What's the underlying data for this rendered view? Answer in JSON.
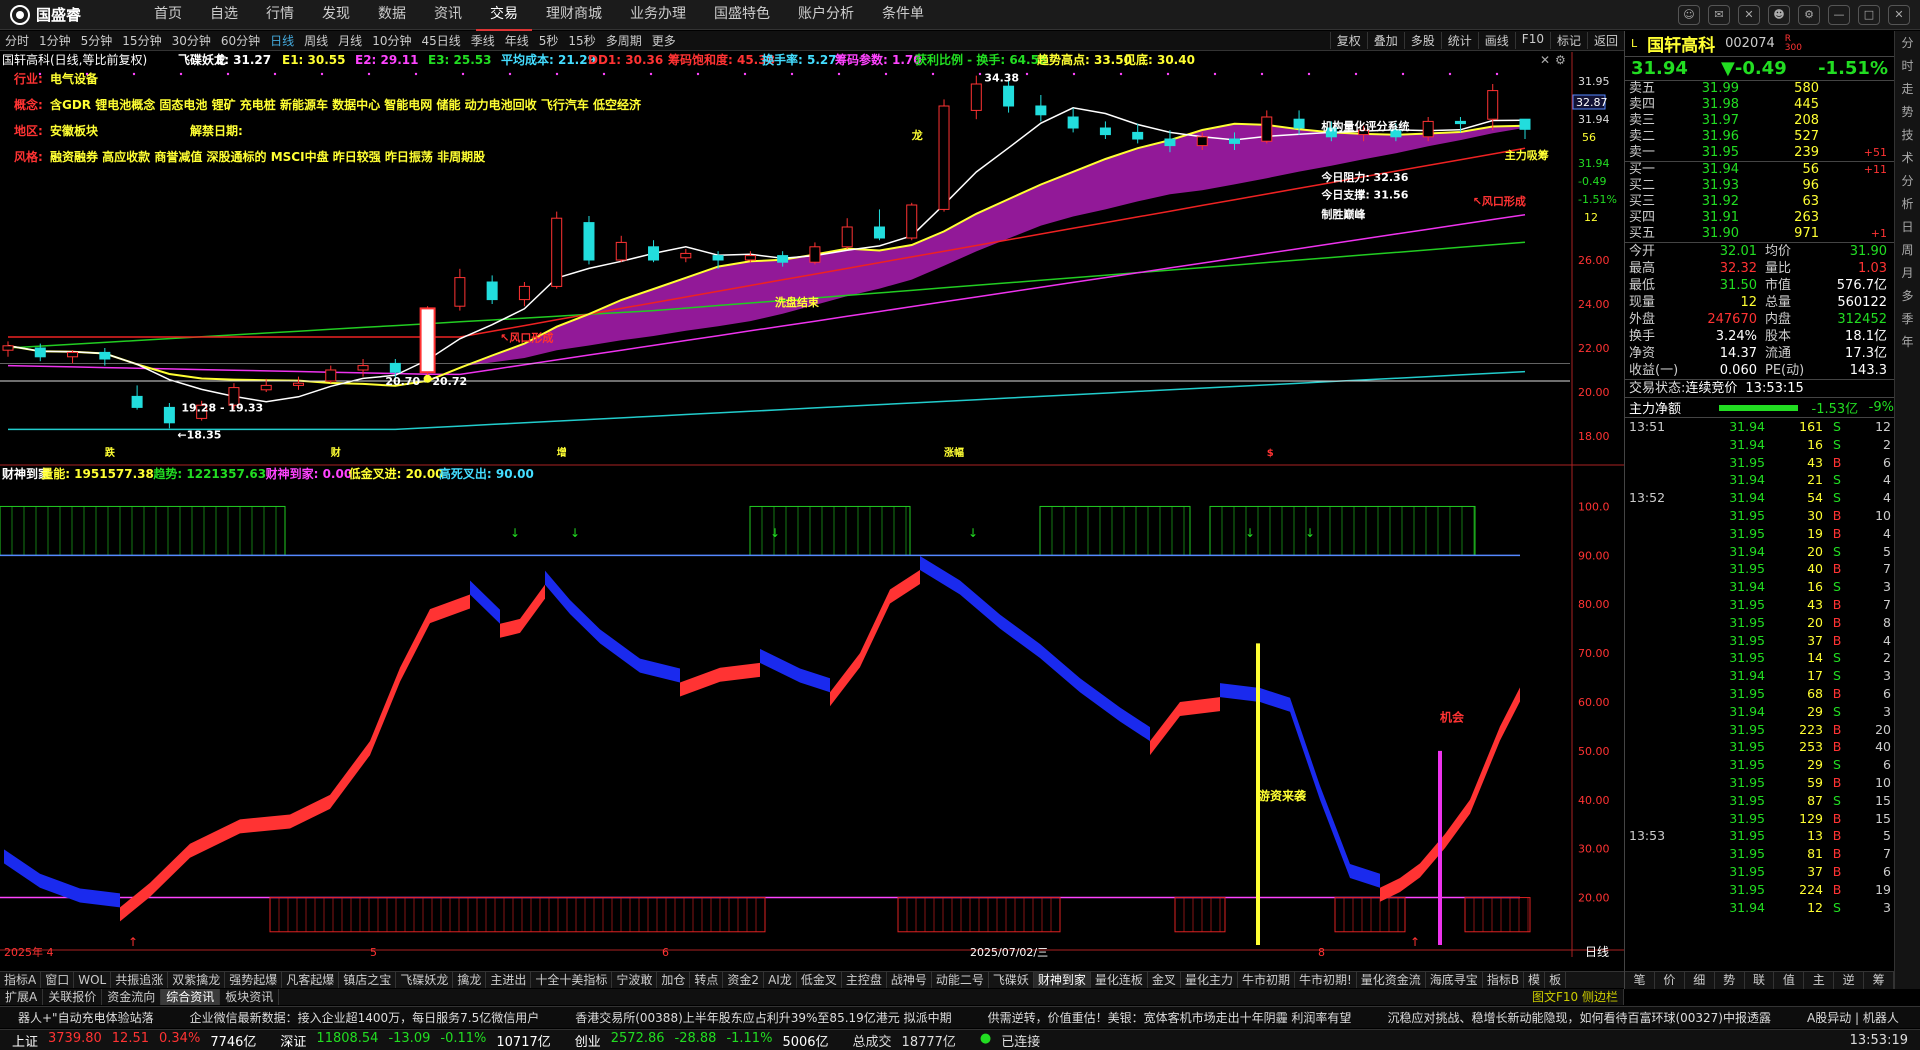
{
  "topbar": {
    "logo": "国盛睿",
    "menu": [
      "首页",
      "自选",
      "行情",
      "发现",
      "数据",
      "资讯",
      "交易",
      "理财商城",
      "业务办理",
      "国盛特色",
      "账户分析",
      "条件单"
    ],
    "active": "交易"
  },
  "periods": [
    "分时",
    "1分钟",
    "5分钟",
    "15分钟",
    "30分钟",
    "60分钟",
    "日线",
    "周线",
    "月线",
    "10分钟",
    "45日线",
    "季线",
    "年线",
    "5秒",
    "15秒",
    "多周期",
    "更多"
  ],
  "period_active": "日线",
  "chart_tools": [
    "复权",
    "叠加",
    "多股",
    "统计",
    "画线",
    "F10",
    "标记",
    "返回"
  ],
  "header": {
    "title": "国轩高科(日线,等比前复权)",
    "items": [
      {
        "t": "飞碟妖龙",
        "c": "#fff"
      },
      {
        "t": "E: 31.27",
        "c": "#fff"
      },
      {
        "t": "E1: 30.55",
        "c": "#ff3"
      },
      {
        "t": "E2: 29.11",
        "c": "#f4f"
      },
      {
        "t": "E3: 25.53",
        "c": "#2d2"
      },
      {
        "t": "平均成本: 21.29",
        "c": "#4df"
      },
      {
        "t": "DD1: 30.36",
        "c": "#f33"
      },
      {
        "t": "筹码饱和度: 45.38",
        "c": "#f33"
      },
      {
        "t": "换手率: 5.27",
        "c": "#4df"
      },
      {
        "t": "筹码参数: 1.70",
        "c": "#f4f"
      },
      {
        "t": "获利比例 - 换手: 64.58",
        "c": "#2d2"
      },
      {
        "t": "趋势高点: 33.50",
        "c": "#ff3"
      },
      {
        "t": "见底: 30.40",
        "c": "#ff3"
      }
    ]
  },
  "info": [
    {
      "label": "行业:",
      "text": "电气设备"
    },
    {
      "label": "概念:",
      "text": "含GDR 锂电池概念 固态电池 锂矿 充电桩 新能源车 数据中心 智能电网 储能 动力电池回收 飞行汽车 低空经济"
    },
    {
      "label": "地区:",
      "text": "安徽板块",
      "extra": "解禁日期:"
    },
    {
      "label": "风格:",
      "text": "融资融券 高应收款 商誉减值 深股通标的 MSCI中盘 昨日较强 昨日振荡 非周期股"
    }
  ],
  "price_axis": [
    "31.95",
    "31.94",
    "31.94",
    "-0.49",
    "-1.51%",
    "26.00",
    "24.00",
    "22.00",
    "20.00",
    "18.00"
  ],
  "price_box": "32.87",
  "volume_box": "56",
  "small_axis": "12",
  "annot": {
    "high": "34.38",
    "low1": "19.28 - 19.33",
    "low2": "18.35",
    "low3": "20.70 - 20.72",
    "wash": "洗盘结束",
    "wind1": "风口形成",
    "wind2": "风口形成",
    "dragon": "龙",
    "system": "机构量化评分系统",
    "power": "主力吸筹",
    "resist": "今日阻力: 32.36",
    "support": "今日支撑: 31.56",
    "peak": "制胜巅峰",
    "marks": [
      "跌",
      "财",
      "增",
      "涨幅",
      "$"
    ]
  },
  "sub": {
    "items": [
      {
        "t": "财神到家",
        "c": "#fff"
      },
      {
        "t": "量能: 1951577.38",
        "c": "#ff3"
      },
      {
        "t": "趋势: 1221357.63",
        "c": "#2d2"
      },
      {
        "t": "财神到家: 0.00",
        "c": "#f4f"
      },
      {
        "t": "低金叉进: 20.00",
        "c": "#ff3"
      },
      {
        "t": "高死叉出: 90.00",
        "c": "#4df"
      }
    ],
    "axis": [
      "100.0",
      "90.00",
      "80.00",
      "70.00",
      "60.00",
      "50.00",
      "40.00",
      "30.00",
      "20.00"
    ],
    "fund": "游资来袭",
    "chance": "机会"
  },
  "dates": [
    "2025年 4",
    "5",
    "6",
    "2025/07/02/三",
    "8"
  ],
  "date_right": "日线",
  "indicator_tabs": [
    "指标A",
    "窗口",
    "WOL",
    "共振追涨",
    "双紫擒龙",
    "强势起爆",
    "凡客起爆",
    "镇店之宝",
    "飞碟妖龙",
    "擒龙",
    "主进出",
    "十全十美指标",
    "宁波敢",
    "加仓",
    "转点",
    "资金2",
    "AI龙",
    "低金叉",
    "主控盘",
    "战神号",
    "动能二号",
    "飞碟妖",
    "财神到家",
    "量化连板",
    "金叉",
    "量化主力",
    "牛市初期",
    "牛市初期!",
    "量化资金流",
    "海底寻宝",
    "指标B",
    "模",
    "板"
  ],
  "indicator_active": "财神到家",
  "ext_tabs": [
    "扩展A",
    "关联报价",
    "资金流向",
    "综合资讯",
    "板块资讯"
  ],
  "ext_active": "综合资讯",
  "ext_right": "图文F10 侧边栏",
  "quote": {
    "name": "国轩高科",
    "code": "002074",
    "tag": "R 300",
    "price": "31.94",
    "change": "▼-0.49",
    "pct": "-1.51%",
    "sell": [
      {
        "l": "卖五",
        "p": "31.99",
        "v": "580",
        "c": ""
      },
      {
        "l": "卖四",
        "p": "31.98",
        "v": "445",
        "c": ""
      },
      {
        "l": "卖三",
        "p": "31.97",
        "v": "208",
        "c": ""
      },
      {
        "l": "卖二",
        "p": "31.96",
        "v": "527",
        "c": ""
      },
      {
        "l": "卖一",
        "p": "31.95",
        "v": "239",
        "c": "+51"
      }
    ],
    "buy": [
      {
        "l": "买一",
        "p": "31.94",
        "v": "56",
        "c": "+11"
      },
      {
        "l": "买二",
        "p": "31.93",
        "v": "96",
        "c": ""
      },
      {
        "l": "买三",
        "p": "31.92",
        "v": "63",
        "c": ""
      },
      {
        "l": "买四",
        "p": "31.91",
        "v": "263",
        "c": ""
      },
      {
        "l": "买五",
        "p": "31.90",
        "v": "971",
        "c": "+1"
      }
    ],
    "stats": [
      [
        "今开",
        "32.01",
        "均价",
        "31.90"
      ],
      [
        "最高",
        "32.32",
        "量比",
        "1.03"
      ],
      [
        "最低",
        "31.50",
        "市值",
        "576.7亿"
      ],
      [
        "现量",
        "12",
        "总量",
        "560122"
      ],
      [
        "外盘",
        "247670",
        "内盘",
        "312452"
      ],
      [
        "换手",
        "3.24%",
        "股本",
        "18.1亿"
      ],
      [
        "净资",
        "14.37",
        "流通",
        "17.3亿"
      ],
      [
        "收益(一)",
        "0.060",
        "PE(动)",
        "143.3"
      ]
    ],
    "state_label": "交易状态:",
    "state": "连续竞价",
    "state_time": "13:53:15",
    "flow_label": "主力净额",
    "flow": "-1.53亿",
    "flow_pct": "-9%",
    "ticks": [
      {
        "t": "13:51",
        "p": "31.94",
        "v": "161",
        "s": "S",
        "n": "12"
      },
      {
        "t": "",
        "p": "31.94",
        "v": "16",
        "s": "S",
        "n": "2"
      },
      {
        "t": "",
        "p": "31.95",
        "v": "43",
        "s": "B",
        "n": "6"
      },
      {
        "t": "",
        "p": "31.94",
        "v": "21",
        "s": "S",
        "n": "4"
      },
      {
        "t": "13:52",
        "p": "31.94",
        "v": "54",
        "s": "S",
        "n": "4"
      },
      {
        "t": "",
        "p": "31.95",
        "v": "30",
        "s": "B",
        "n": "10"
      },
      {
        "t": "",
        "p": "31.95",
        "v": "19",
        "s": "B",
        "n": "4"
      },
      {
        "t": "",
        "p": "31.94",
        "v": "20",
        "s": "S",
        "n": "5"
      },
      {
        "t": "",
        "p": "31.95",
        "v": "40",
        "s": "B",
        "n": "7"
      },
      {
        "t": "",
        "p": "31.94",
        "v": "16",
        "s": "S",
        "n": "3"
      },
      {
        "t": "",
        "p": "31.95",
        "v": "43",
        "s": "B",
        "n": "7"
      },
      {
        "t": "",
        "p": "31.95",
        "v": "20",
        "s": "B",
        "n": "8"
      },
      {
        "t": "",
        "p": "31.95",
        "v": "37",
        "s": "B",
        "n": "4"
      },
      {
        "t": "",
        "p": "31.95",
        "v": "14",
        "s": "S",
        "n": "2"
      },
      {
        "t": "",
        "p": "31.94",
        "v": "17",
        "s": "S",
        "n": "3"
      },
      {
        "t": "",
        "p": "31.95",
        "v": "68",
        "s": "B",
        "n": "6"
      },
      {
        "t": "",
        "p": "31.94",
        "v": "29",
        "s": "S",
        "n": "3"
      },
      {
        "t": "",
        "p": "31.95",
        "v": "223",
        "s": "B",
        "n": "20"
      },
      {
        "t": "",
        "p": "31.95",
        "v": "253",
        "s": "B",
        "n": "40"
      },
      {
        "t": "",
        "p": "31.95",
        "v": "29",
        "s": "S",
        "n": "6"
      },
      {
        "t": "",
        "p": "31.95",
        "v": "59",
        "s": "B",
        "n": "10"
      },
      {
        "t": "",
        "p": "31.95",
        "v": "87",
        "s": "S",
        "n": "15"
      },
      {
        "t": "",
        "p": "31.95",
        "v": "129",
        "s": "B",
        "n": "15"
      },
      {
        "t": "13:53",
        "p": "31.95",
        "v": "13",
        "s": "B",
        "n": "5"
      },
      {
        "t": "",
        "p": "31.95",
        "v": "81",
        "s": "B",
        "n": "7"
      },
      {
        "t": "",
        "p": "31.95",
        "v": "37",
        "s": "B",
        "n": "6"
      },
      {
        "t": "",
        "p": "31.95",
        "v": "224",
        "s": "B",
        "n": "19"
      },
      {
        "t": "",
        "p": "31.94",
        "v": "12",
        "s": "S",
        "n": "3"
      }
    ],
    "bottom_tabs": [
      "笔",
      "价",
      "细",
      "势",
      "联",
      "值",
      "主",
      "逆",
      "筹"
    ]
  },
  "vtabs": [
    "分",
    "时",
    "走",
    "势",
    "技",
    "术",
    "分",
    "析",
    "日",
    "周",
    "月",
    "多",
    "季",
    "年"
  ],
  "ticker": [
    "器人+\"自动充电体验站落",
    "企业微信最新数据：接入企业超1400万，每日服务7.5亿微信用户",
    "香港交易所(00388)上半年股东应占利升39%至85.19亿港元 拟派中期",
    "供需逆转，价值重估！美银：宽体客机市场走出十年阴霾 利润率有望",
    "沉稳应对挑战、稳增长新动能隐现，如何看待百富环球(00327)中报透露",
    "A股异动 | 机器人"
  ],
  "status": [
    {
      "name": "上证",
      "v": "3739.80",
      "c": "12.51",
      "p": "0.34%",
      "a": "7746亿"
    },
    {
      "name": "深证",
      "v": "11808.54",
      "c": "-13.09",
      "p": "-0.11%",
      "a": "10717亿"
    },
    {
      "name": "创业",
      "v": "2572.86",
      "c": "-28.88",
      "p": "-1.11%",
      "a": "5006亿"
    }
  ],
  "total_label": "总成交",
  "total": "18777亿",
  "connected": "已连接",
  "clock": "13:53:19",
  "chart_data": {
    "type": "candlestick",
    "price_range": [
      17.5,
      35
    ],
    "candles_approx": [
      [
        21.9,
        22.1,
        22.3,
        21.6
      ],
      [
        22.0,
        21.6,
        22.2,
        21.4
      ],
      [
        21.6,
        21.8,
        21.9,
        21.3
      ],
      [
        21.8,
        21.5,
        22.0,
        21.2
      ],
      [
        19.8,
        19.3,
        20.3,
        19.2
      ],
      [
        19.3,
        18.6,
        19.5,
        18.35
      ],
      [
        18.8,
        19.4,
        19.6,
        18.7
      ],
      [
        19.4,
        20.2,
        20.4,
        19.2
      ],
      [
        20.1,
        20.3,
        20.6,
        20.0
      ],
      [
        20.3,
        20.4,
        20.7,
        20.1
      ],
      [
        20.5,
        21.0,
        21.2,
        20.4
      ],
      [
        21.0,
        21.2,
        21.5,
        20.7
      ],
      [
        21.3,
        20.9,
        21.5,
        20.6
      ],
      [
        20.9,
        23.8,
        23.9,
        20.7
      ],
      [
        23.9,
        25.2,
        25.6,
        23.7
      ],
      [
        25.0,
        24.2,
        25.3,
        24.0
      ],
      [
        24.2,
        24.8,
        25.0,
        23.9
      ],
      [
        24.8,
        27.9,
        28.2,
        24.7
      ],
      [
        27.7,
        26.0,
        28.0,
        25.8
      ],
      [
        26.0,
        26.8,
        27.1,
        25.9
      ],
      [
        26.6,
        26.0,
        26.9,
        25.9
      ],
      [
        26.1,
        26.3,
        26.5,
        25.9
      ],
      [
        26.2,
        26.0,
        26.4,
        25.6
      ],
      [
        26.0,
        26.2,
        26.4,
        25.9
      ],
      [
        26.2,
        25.9,
        26.4,
        25.7
      ],
      [
        25.9,
        26.6,
        26.8,
        25.8
      ],
      [
        26.6,
        27.5,
        27.9,
        26.5
      ],
      [
        27.5,
        27.0,
        28.3,
        26.9
      ],
      [
        27.0,
        28.5,
        28.6,
        26.9
      ],
      [
        28.3,
        33.0,
        33.3,
        28.2
      ],
      [
        32.8,
        34.0,
        34.38,
        32.4
      ],
      [
        33.9,
        33.0,
        34.2,
        32.7
      ],
      [
        33.0,
        32.6,
        33.5,
        32.3
      ],
      [
        32.5,
        32.0,
        32.9,
        31.8
      ],
      [
        32.0,
        31.7,
        32.3,
        31.5
      ],
      [
        31.8,
        31.5,
        32.2,
        31.3
      ],
      [
        31.5,
        31.2,
        31.9,
        30.9
      ],
      [
        31.2,
        31.6,
        31.8,
        31.0
      ],
      [
        31.5,
        31.3,
        31.8,
        31.0
      ],
      [
        31.4,
        32.5,
        32.8,
        31.3
      ],
      [
        32.4,
        32.0,
        32.8,
        31.7
      ],
      [
        32.0,
        31.6,
        32.3,
        31.4
      ],
      [
        31.7,
        31.9,
        32.1,
        31.4
      ],
      [
        31.9,
        31.6,
        32.2,
        31.4
      ],
      [
        31.6,
        32.3,
        32.5,
        31.4
      ],
      [
        32.3,
        32.2,
        32.5,
        31.8
      ],
      [
        32.4,
        33.7,
        34.0,
        31.9
      ],
      [
        32.4,
        31.94,
        32.32,
        31.5
      ]
    ],
    "sub_range": [
      15,
      105
    ]
  }
}
